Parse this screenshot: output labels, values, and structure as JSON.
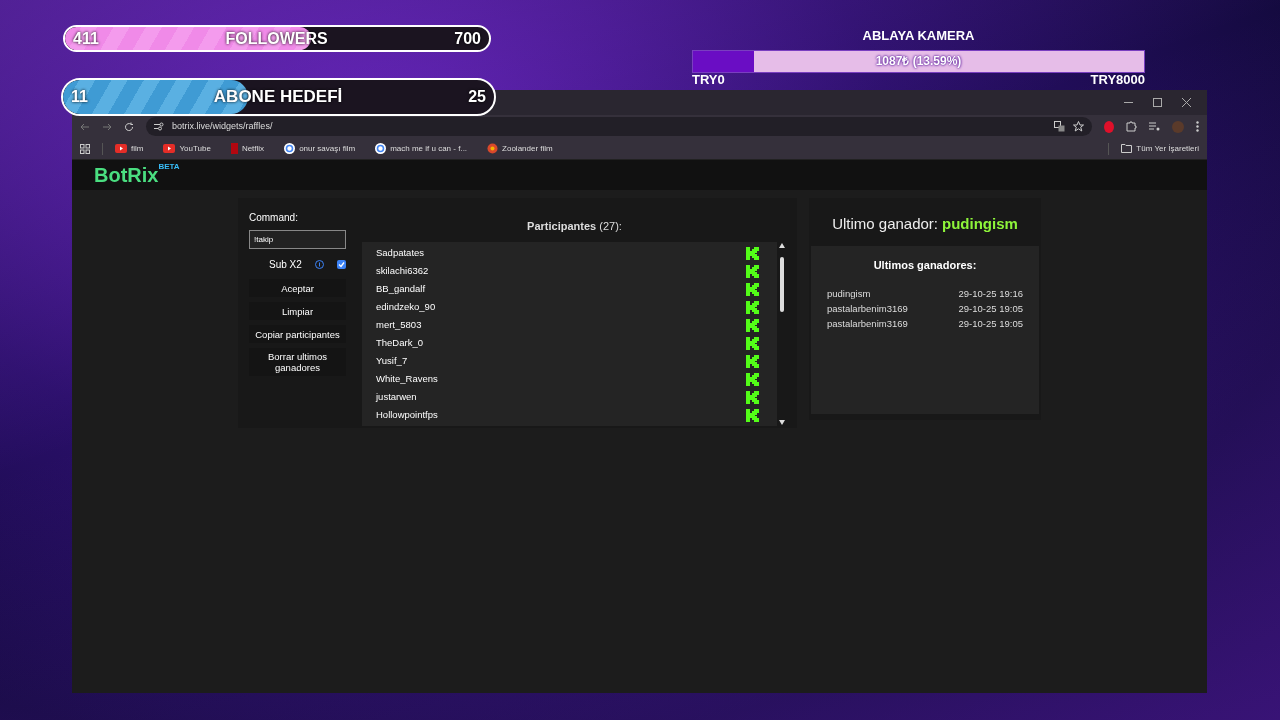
{
  "overlays": {
    "followers": {
      "current": "411",
      "label": "FOLLOWERS",
      "goal": "700",
      "level": 0.58
    },
    "subscribers": {
      "current": "11",
      "label": "ABONE HEDEFİ",
      "goal": "25",
      "level": 0.43
    },
    "donation": {
      "title": "ABLAYA KAMERA",
      "reading": "1087₺ (13.59%)",
      "level": 0.136,
      "min": "TRY0",
      "max": "TRY8000"
    }
  },
  "browser": {
    "url": "botrix.live/widgets/raffles/",
    "bookmarks": [
      {
        "label": "film",
        "kind": "youtube"
      },
      {
        "label": "YouTube",
        "kind": "youtube"
      },
      {
        "label": "Netflix",
        "kind": "netflix"
      },
      {
        "label": "onur savaşı film",
        "kind": "google"
      },
      {
        "label": "mach me if u can - f...",
        "kind": "google"
      },
      {
        "label": "Zoolander film",
        "kind": "site"
      }
    ],
    "all_bookmarks": "Tüm Yer İşaretleri"
  },
  "app": {
    "logo": "BotRix",
    "logo_badge": "BETA",
    "command_label": "Command:",
    "command_value": "!takip",
    "sub_x2": {
      "label": "Sub X2",
      "checked": true
    },
    "buttons": [
      "Aceptar",
      "Limpiar",
      "Copiar participantes",
      "Borrar ultimos ganadores"
    ],
    "participants_title": "**Participantes** (27):",
    "participants": [
      "Sadpatates",
      "skilachi6362",
      "BB_gandalf",
      "edindzeko_90",
      "mert_5803",
      "TheDark_0",
      "Yusif_7",
      "White_Ravens",
      "justarwen",
      "Hollowpointfps"
    ],
    "last_winner_label": "Ultimo ganador:",
    "last_winner": "pudingism",
    "winners_title": "Ultimos ganadores:",
    "winners": [
      {
        "name": "pudingism",
        "time": "29-10-25 19:16"
      },
      {
        "name": "pastalarbenim3169",
        "time": "29-10-25 19:05"
      },
      {
        "name": "pastalarbenim3169",
        "time": "29-10-25 19:05"
      }
    ]
  }
}
